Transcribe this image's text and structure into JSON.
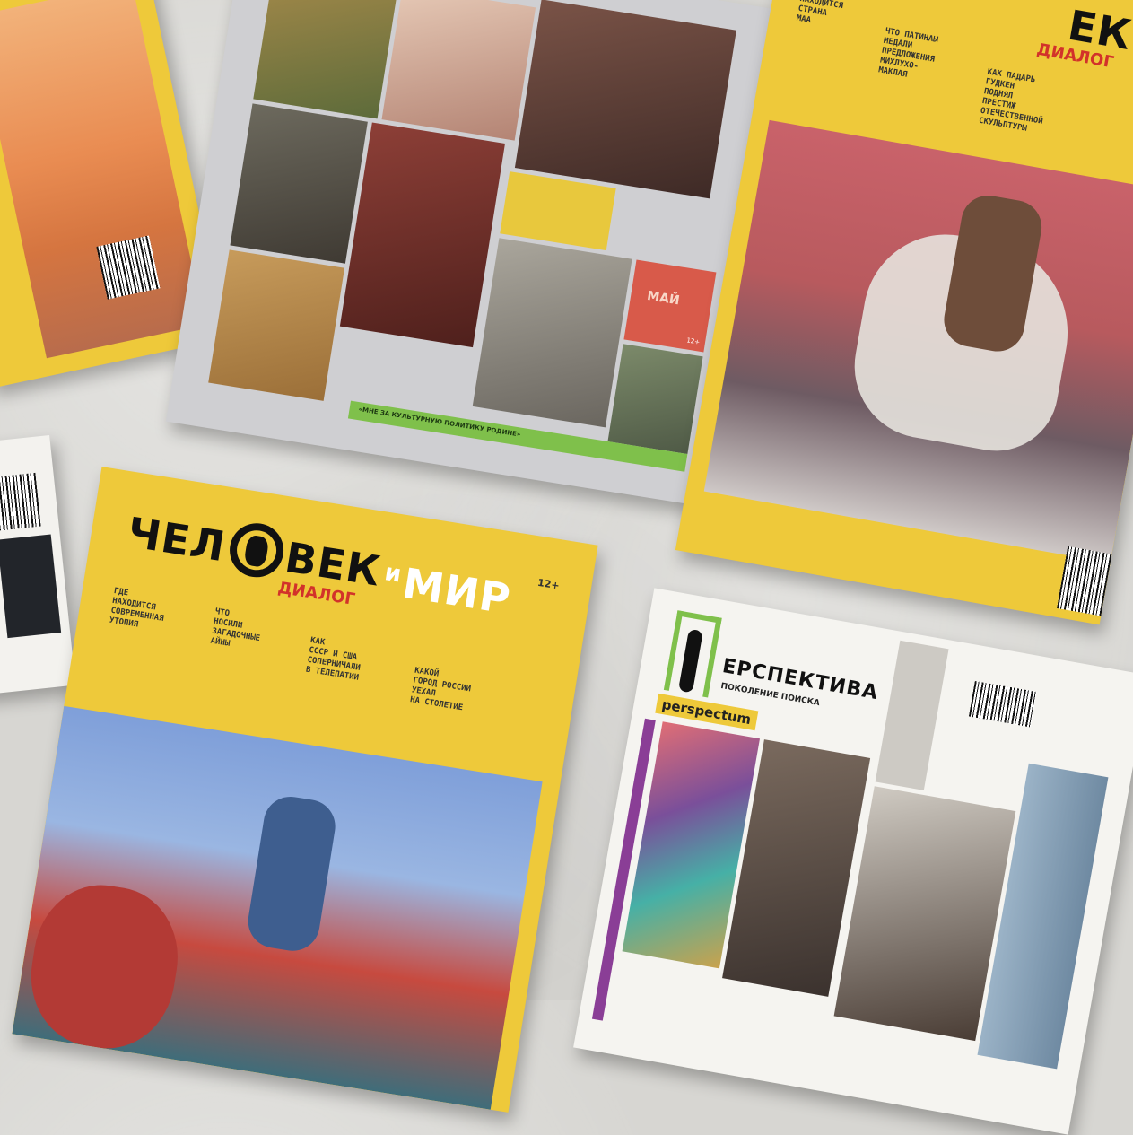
{
  "mag_top_right": {
    "logo_part": "ЕК",
    "sub": "ДИАЛОГ",
    "col1": "ГДЕ\nНАХОДИТСЯ\nСТРАНА\nМАА",
    "col2": "ЧТО ПАТИНАЫ\nМЕДАЛИ\nПРЕДЛОЖЕНИЯ\nМИХЛУХО-\nМАКЛАЯ",
    "col3": "КАК ПАДАРЬ\nГУДКЕН\nПОДНЯЛ\nПРЕСТИЖ\nОТЕЧЕСТВЕННОЙ\nСКУЛЬПТУРЫ"
  },
  "mag_top_center": {
    "month": "МАЙ",
    "age": "12+",
    "quote": "«МНЕ ЗА КУЛЬТУРНУЮ ПОЛИТИКУ РОДИНЕ»"
  },
  "mag_bottom_center": {
    "logo_left": "ЧЕЛ",
    "logo_mid": "ВЕК",
    "logo_i": "и",
    "logo_right": "МИР",
    "sub": "ДИАЛОГ",
    "age": "12+",
    "col1": "ГДЕ\nНАХОДИТСЯ\nСОВРЕМЕННАЯ\nУТОПИЯ",
    "col2": "ЧТО\nНОСИЛИ\nЗАГАДОЧНЫЕ\nАЙНЫ",
    "col3": "КАК\nСССР И США\nСОПЕРНИЧАЛИ\nВ ТЕЛЕПАТИИ",
    "col4": "КАКОЙ\nГОРОД РОССИИ\nУЕХАЛ\nНА СТОЛЕТИЕ"
  },
  "mag_bottom_right": {
    "logo": "ЕРСПЕКТИВА",
    "sub": "ПОКОЛЕНИЕ ПОИСКА",
    "tag": "perspectum"
  },
  "colors": {
    "yellow": "#eec93a",
    "red": "#d2322a",
    "green": "#7fc04b",
    "purple": "#8a3e96"
  }
}
